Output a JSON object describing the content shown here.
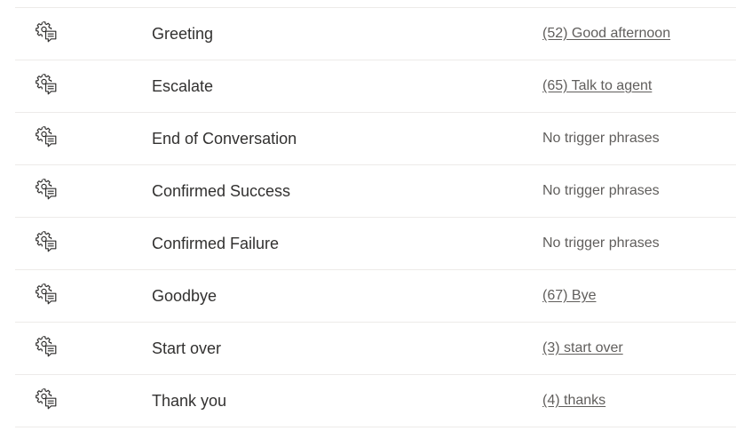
{
  "topics": [
    {
      "icon": "gear-chat-icon",
      "name": "Greeting",
      "trigger": "(52) Good afternoon",
      "has_trigger": true
    },
    {
      "icon": "gear-chat-icon",
      "name": "Escalate",
      "trigger": "(65) Talk to agent",
      "has_trigger": true
    },
    {
      "icon": "gear-chat-icon",
      "name": "End of Conversation",
      "trigger": "No trigger phrases",
      "has_trigger": false
    },
    {
      "icon": "gear-chat-icon",
      "name": "Confirmed Success",
      "trigger": "No trigger phrases",
      "has_trigger": false
    },
    {
      "icon": "gear-chat-icon",
      "name": "Confirmed Failure",
      "trigger": "No trigger phrases",
      "has_trigger": false
    },
    {
      "icon": "gear-chat-icon",
      "name": "Goodbye",
      "trigger": "(67) Bye",
      "has_trigger": true
    },
    {
      "icon": "gear-chat-icon",
      "name": "Start over",
      "trigger": "(3) start over",
      "has_trigger": true
    },
    {
      "icon": "gear-chat-icon",
      "name": "Thank you",
      "trigger": "(4) thanks",
      "has_trigger": true
    }
  ],
  "colors": {
    "text": "#323130",
    "secondary_text": "#605e5c",
    "divider": "#edebe9"
  }
}
